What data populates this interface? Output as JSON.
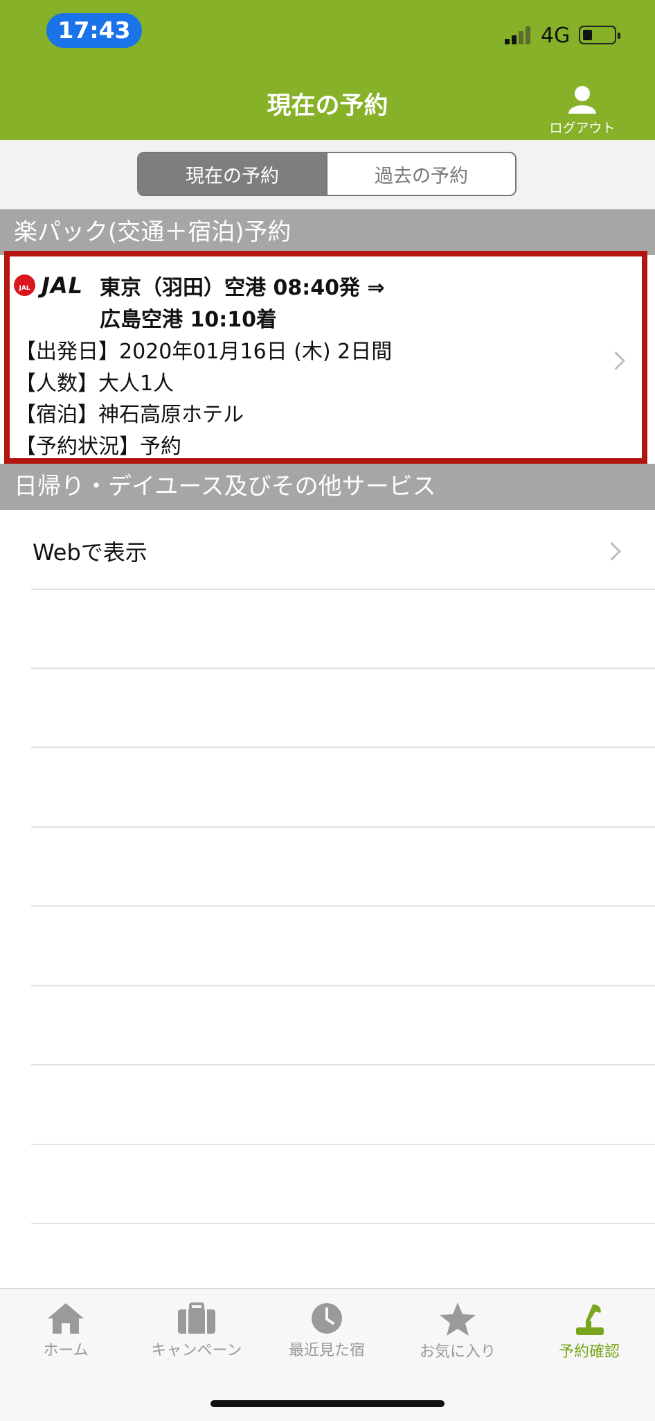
{
  "status_bar": {
    "time": "17:43",
    "network": "4G"
  },
  "header": {
    "title": "現在の予約",
    "logout_label": "ログアウト",
    "logout_icon": "person-icon"
  },
  "segments": {
    "current": "現在の予約",
    "past": "過去の予約"
  },
  "sections": {
    "package": "楽パック(交通＋宿泊)予約",
    "daytrip": "日帰り・デイユース及びその他サービス"
  },
  "booking": {
    "airline_logo": "JAL",
    "flight_line1": "東京（羽田）空港 08:40発 ⇒",
    "flight_line2": "広島空港 10:10着",
    "departure": "【出発日】2020年01月16日 (木)  2日間",
    "guests": "【人数】大人1人",
    "hotel": "【宿泊】神石高原ホテル",
    "status": "【予約状況】予約"
  },
  "web_view_label": "Webで表示",
  "tabs": [
    {
      "label": "ホーム",
      "icon": "home-icon"
    },
    {
      "label": "キャンペーン",
      "icon": "briefcase-icon"
    },
    {
      "label": "最近見た宿",
      "icon": "clock-icon"
    },
    {
      "label": "お気に入り",
      "icon": "star-icon"
    },
    {
      "label": "予約確認",
      "icon": "bell-icon",
      "active": true
    }
  ],
  "colors": {
    "brand_green": "#87b128",
    "highlight_red": "#b3150f",
    "active_tab": "#78a61c"
  }
}
